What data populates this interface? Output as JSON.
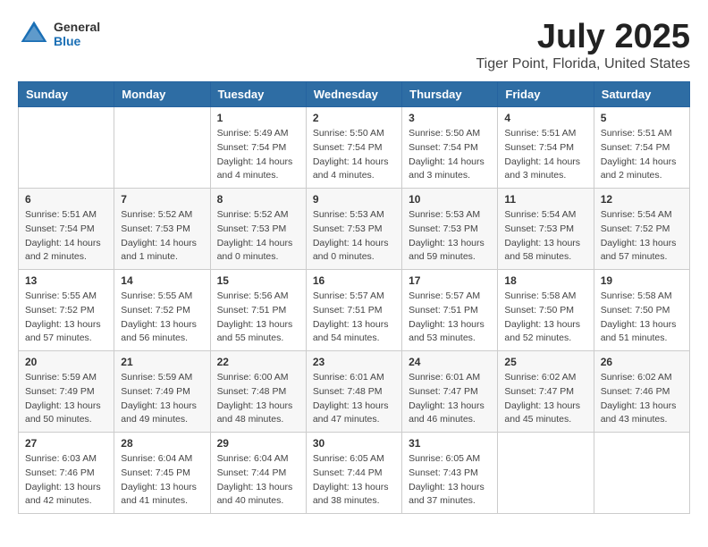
{
  "header": {
    "logo_general": "General",
    "logo_blue": "Blue",
    "title": "July 2025",
    "subtitle": "Tiger Point, Florida, United States"
  },
  "days_of_week": [
    "Sunday",
    "Monday",
    "Tuesday",
    "Wednesday",
    "Thursday",
    "Friday",
    "Saturday"
  ],
  "weeks": [
    [
      {
        "day": "",
        "info": ""
      },
      {
        "day": "",
        "info": ""
      },
      {
        "day": "1",
        "info": "Sunrise: 5:49 AM\nSunset: 7:54 PM\nDaylight: 14 hours\nand 4 minutes."
      },
      {
        "day": "2",
        "info": "Sunrise: 5:50 AM\nSunset: 7:54 PM\nDaylight: 14 hours\nand 4 minutes."
      },
      {
        "day": "3",
        "info": "Sunrise: 5:50 AM\nSunset: 7:54 PM\nDaylight: 14 hours\nand 3 minutes."
      },
      {
        "day": "4",
        "info": "Sunrise: 5:51 AM\nSunset: 7:54 PM\nDaylight: 14 hours\nand 3 minutes."
      },
      {
        "day": "5",
        "info": "Sunrise: 5:51 AM\nSunset: 7:54 PM\nDaylight: 14 hours\nand 2 minutes."
      }
    ],
    [
      {
        "day": "6",
        "info": "Sunrise: 5:51 AM\nSunset: 7:54 PM\nDaylight: 14 hours\nand 2 minutes."
      },
      {
        "day": "7",
        "info": "Sunrise: 5:52 AM\nSunset: 7:53 PM\nDaylight: 14 hours\nand 1 minute."
      },
      {
        "day": "8",
        "info": "Sunrise: 5:52 AM\nSunset: 7:53 PM\nDaylight: 14 hours\nand 0 minutes."
      },
      {
        "day": "9",
        "info": "Sunrise: 5:53 AM\nSunset: 7:53 PM\nDaylight: 14 hours\nand 0 minutes."
      },
      {
        "day": "10",
        "info": "Sunrise: 5:53 AM\nSunset: 7:53 PM\nDaylight: 13 hours\nand 59 minutes."
      },
      {
        "day": "11",
        "info": "Sunrise: 5:54 AM\nSunset: 7:53 PM\nDaylight: 13 hours\nand 58 minutes."
      },
      {
        "day": "12",
        "info": "Sunrise: 5:54 AM\nSunset: 7:52 PM\nDaylight: 13 hours\nand 57 minutes."
      }
    ],
    [
      {
        "day": "13",
        "info": "Sunrise: 5:55 AM\nSunset: 7:52 PM\nDaylight: 13 hours\nand 57 minutes."
      },
      {
        "day": "14",
        "info": "Sunrise: 5:55 AM\nSunset: 7:52 PM\nDaylight: 13 hours\nand 56 minutes."
      },
      {
        "day": "15",
        "info": "Sunrise: 5:56 AM\nSunset: 7:51 PM\nDaylight: 13 hours\nand 55 minutes."
      },
      {
        "day": "16",
        "info": "Sunrise: 5:57 AM\nSunset: 7:51 PM\nDaylight: 13 hours\nand 54 minutes."
      },
      {
        "day": "17",
        "info": "Sunrise: 5:57 AM\nSunset: 7:51 PM\nDaylight: 13 hours\nand 53 minutes."
      },
      {
        "day": "18",
        "info": "Sunrise: 5:58 AM\nSunset: 7:50 PM\nDaylight: 13 hours\nand 52 minutes."
      },
      {
        "day": "19",
        "info": "Sunrise: 5:58 AM\nSunset: 7:50 PM\nDaylight: 13 hours\nand 51 minutes."
      }
    ],
    [
      {
        "day": "20",
        "info": "Sunrise: 5:59 AM\nSunset: 7:49 PM\nDaylight: 13 hours\nand 50 minutes."
      },
      {
        "day": "21",
        "info": "Sunrise: 5:59 AM\nSunset: 7:49 PM\nDaylight: 13 hours\nand 49 minutes."
      },
      {
        "day": "22",
        "info": "Sunrise: 6:00 AM\nSunset: 7:48 PM\nDaylight: 13 hours\nand 48 minutes."
      },
      {
        "day": "23",
        "info": "Sunrise: 6:01 AM\nSunset: 7:48 PM\nDaylight: 13 hours\nand 47 minutes."
      },
      {
        "day": "24",
        "info": "Sunrise: 6:01 AM\nSunset: 7:47 PM\nDaylight: 13 hours\nand 46 minutes."
      },
      {
        "day": "25",
        "info": "Sunrise: 6:02 AM\nSunset: 7:47 PM\nDaylight: 13 hours\nand 45 minutes."
      },
      {
        "day": "26",
        "info": "Sunrise: 6:02 AM\nSunset: 7:46 PM\nDaylight: 13 hours\nand 43 minutes."
      }
    ],
    [
      {
        "day": "27",
        "info": "Sunrise: 6:03 AM\nSunset: 7:46 PM\nDaylight: 13 hours\nand 42 minutes."
      },
      {
        "day": "28",
        "info": "Sunrise: 6:04 AM\nSunset: 7:45 PM\nDaylight: 13 hours\nand 41 minutes."
      },
      {
        "day": "29",
        "info": "Sunrise: 6:04 AM\nSunset: 7:44 PM\nDaylight: 13 hours\nand 40 minutes."
      },
      {
        "day": "30",
        "info": "Sunrise: 6:05 AM\nSunset: 7:44 PM\nDaylight: 13 hours\nand 38 minutes."
      },
      {
        "day": "31",
        "info": "Sunrise: 6:05 AM\nSunset: 7:43 PM\nDaylight: 13 hours\nand 37 minutes."
      },
      {
        "day": "",
        "info": ""
      },
      {
        "day": "",
        "info": ""
      }
    ]
  ]
}
